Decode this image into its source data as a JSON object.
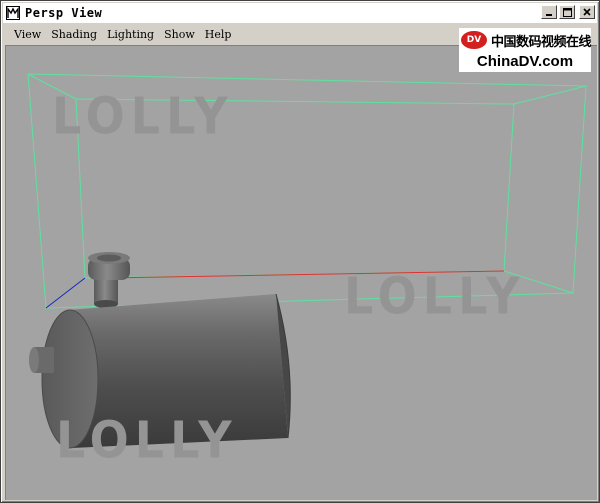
{
  "window": {
    "title": "Persp View",
    "minimize_symbol": "_",
    "maximize_symbol": "□",
    "close_symbol": "×"
  },
  "menu": {
    "items": [
      {
        "label": "View"
      },
      {
        "label": "Shading"
      },
      {
        "label": "Lighting"
      },
      {
        "label": "Show"
      },
      {
        "label": "Help"
      }
    ]
  },
  "logo": {
    "emblem_text": "DV",
    "chinese_text": "中国数码视频在线",
    "site_text": "ChinaDV.com"
  },
  "watermarks": [
    "LOLLY",
    "LOLLY",
    "LOLLY"
  ],
  "scene": {
    "background_color": "#a3a3a3",
    "bounding_box_color": "#5fe0a0",
    "x_axis_color": "#e03030",
    "z_axis_color": "#2020c0",
    "object_color": "#555555"
  }
}
